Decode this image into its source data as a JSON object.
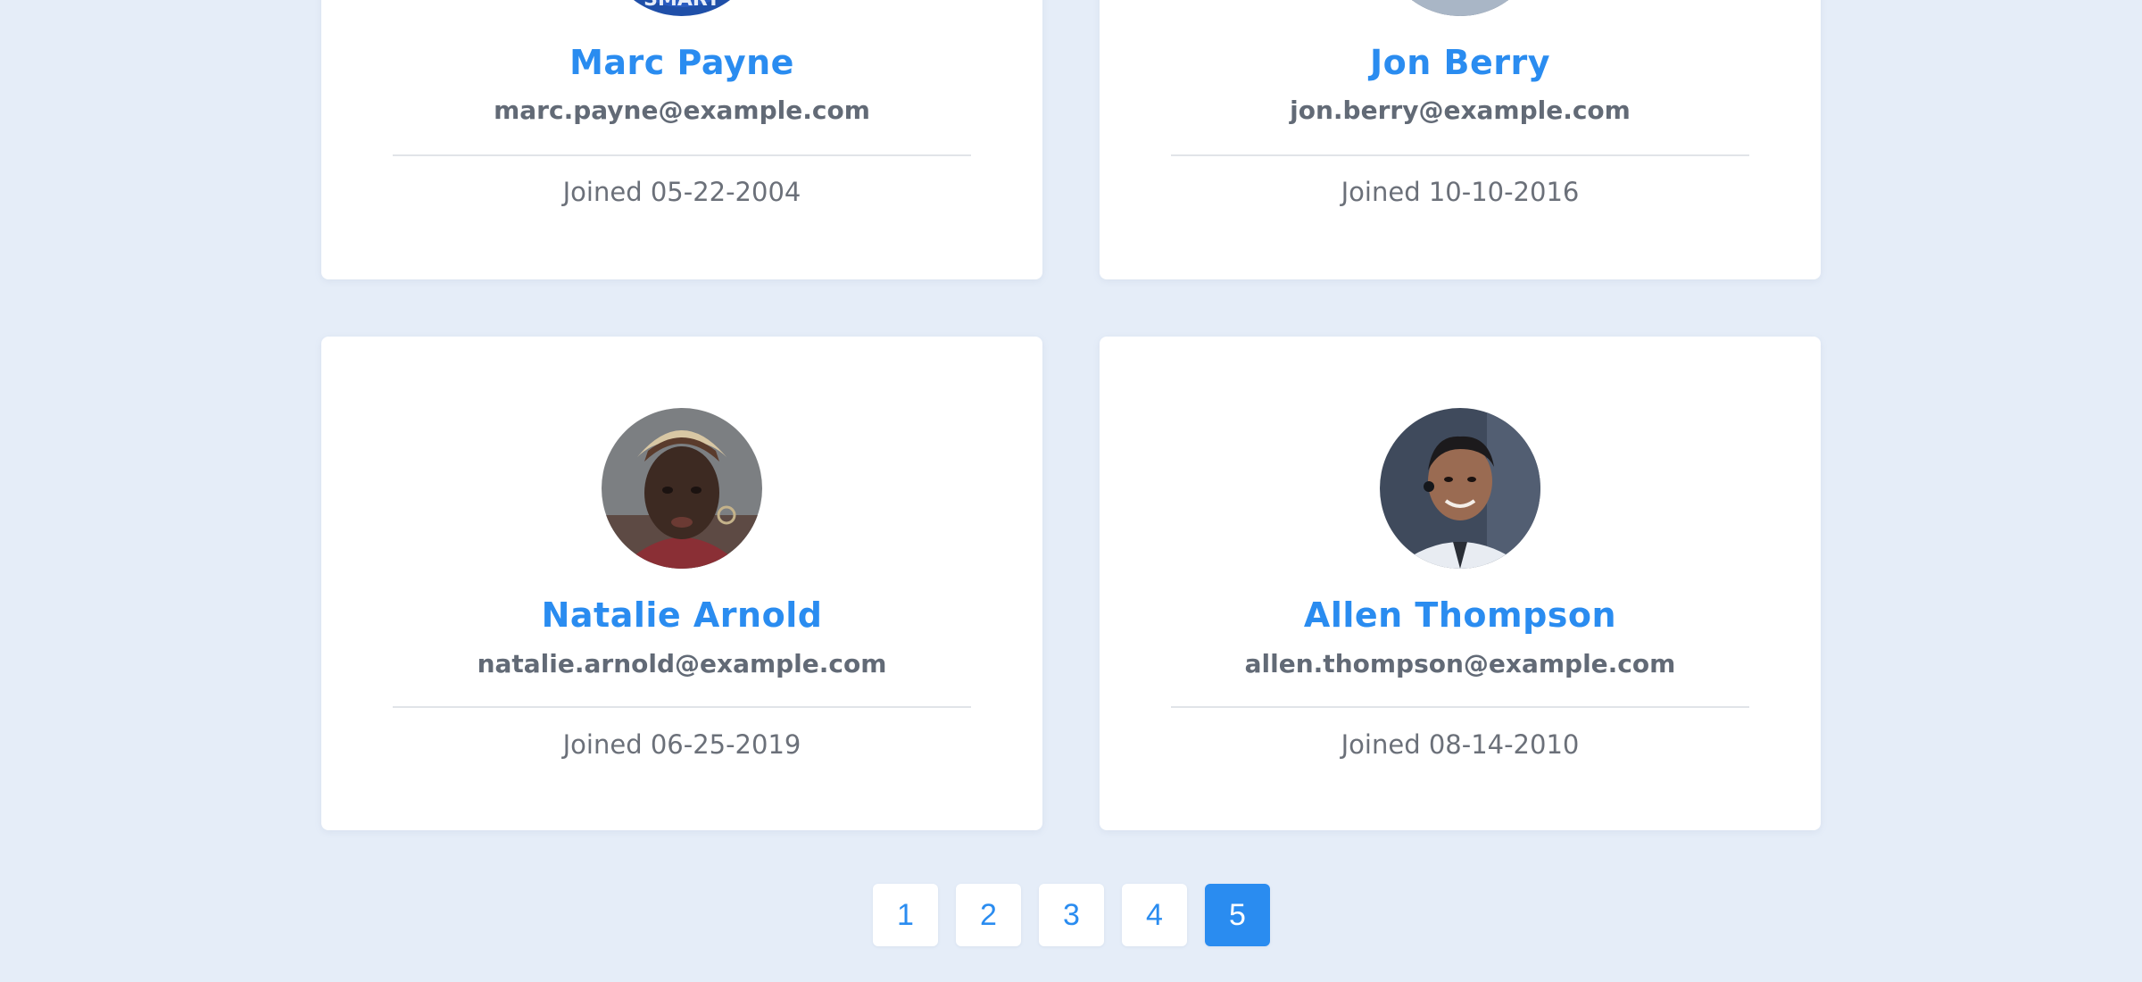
{
  "users": [
    {
      "name": "Marc Payne",
      "email": "marc.payne@example.com",
      "joined": "Joined 05-22-2004",
      "avatar_badge": "SMART"
    },
    {
      "name": "Jon Berry",
      "email": "jon.berry@example.com",
      "joined": "Joined 10-10-2016"
    },
    {
      "name": "Natalie Arnold",
      "email": "natalie.arnold@example.com",
      "joined": "Joined 06-25-2019"
    },
    {
      "name": "Allen Thompson",
      "email": "allen.thompson@example.com",
      "joined": "Joined 08-14-2010"
    }
  ],
  "pagination": {
    "pages": [
      "1",
      "2",
      "3",
      "4",
      "5"
    ],
    "current": "5"
  },
  "colors": {
    "background": "#e5edf8",
    "accent": "#2a8cf0",
    "card": "#ffffff",
    "email_text": "#626a76",
    "joined_text": "#6b7079"
  }
}
